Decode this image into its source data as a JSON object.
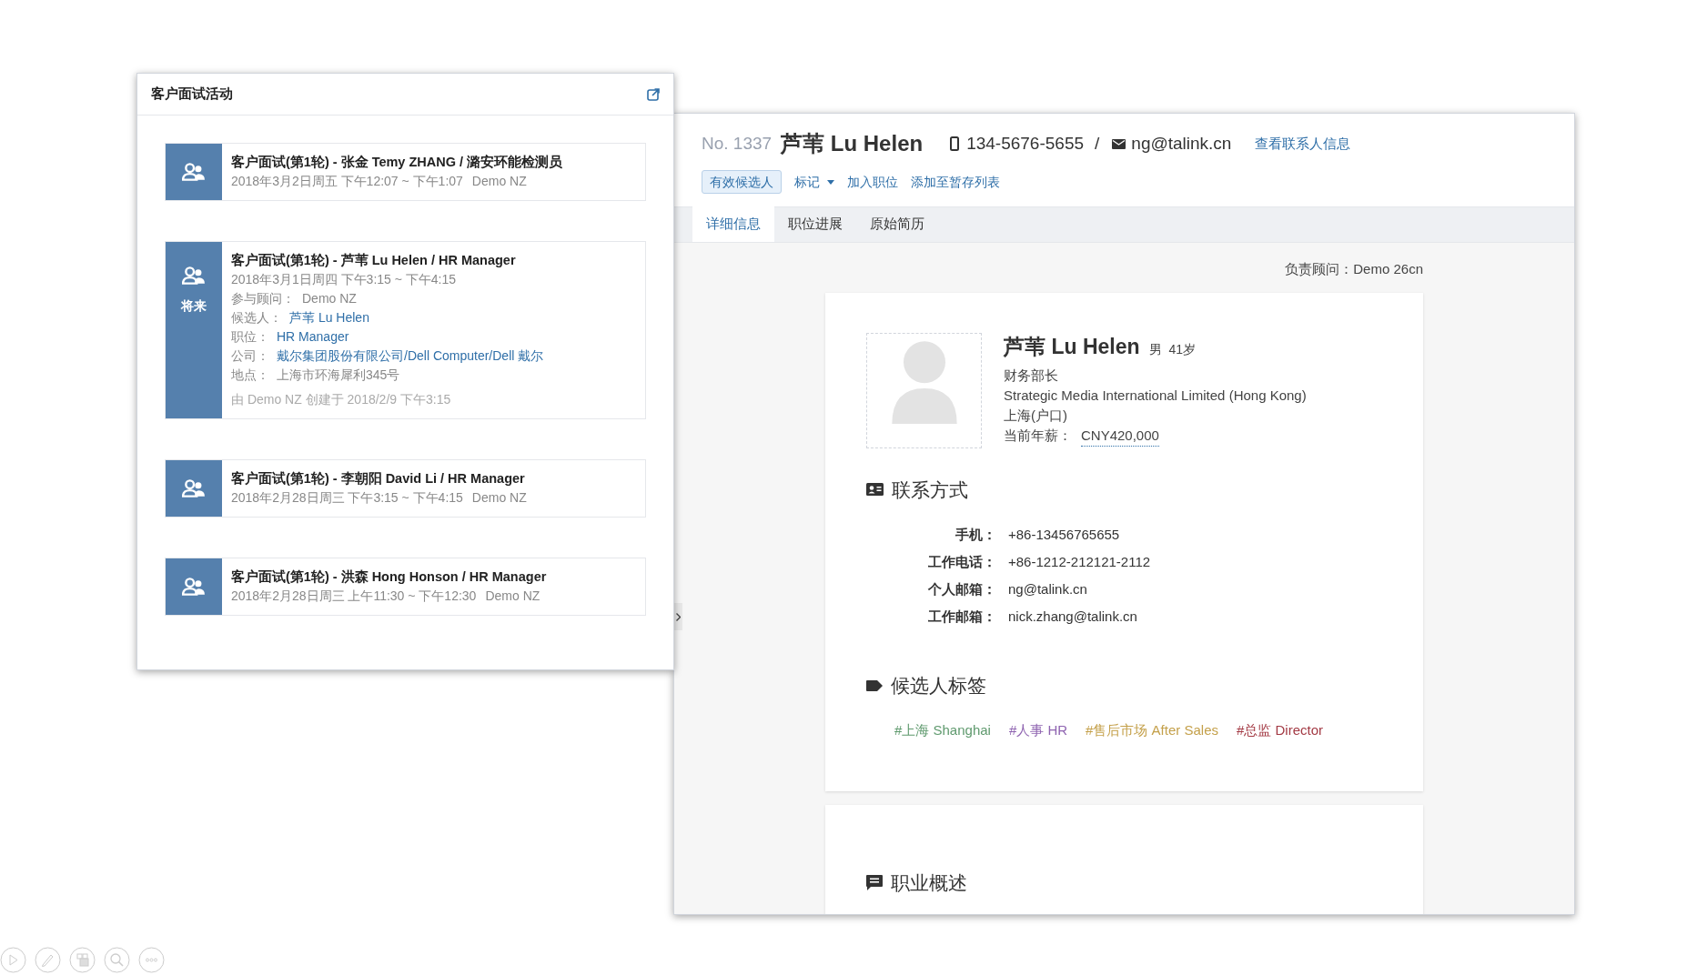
{
  "activity_panel": {
    "title": "客户面试活动",
    "activities": [
      {
        "title": "客户面试(第1轮) - 张金 Temy ZHANG / 潞安环能检测员",
        "time": "2018年3月2日周五 下午12:07 ~ 下午1:07",
        "consultant": "Demo NZ"
      },
      {
        "title": "客户面试(第1轮) - 芦苇 Lu Helen / HR Manager",
        "badge": "将来",
        "time": "2018年3月1日周四 下午3:15 ~ 下午4:15",
        "details": [
          {
            "label": "参与顾问：",
            "value": "Demo NZ",
            "link": false
          },
          {
            "label": "候选人：",
            "value": "芦苇 Lu Helen",
            "link": true
          },
          {
            "label": "职位：",
            "value": "HR Manager",
            "link": true
          },
          {
            "label": "公司：",
            "value": "戴尔集团股份有限公司/Dell Computer/Dell 戴尔",
            "link": true
          },
          {
            "label": "地点：",
            "value": "上海市环海犀利345号",
            "link": false
          }
        ],
        "created": "由 Demo NZ 创建于 2018/2/9 下午3:15"
      },
      {
        "title": "客户面试(第1轮) - 李朝阳 David Li / HR Manager",
        "time": "2018年2月28日周三 下午3:15 ~ 下午4:15",
        "consultant": "Demo NZ"
      },
      {
        "title": "客户面试(第1轮) - 洪森 Hong Honson / HR Manager",
        "time": "2018年2月28日周三 上午11:30 ~ 下午12:30",
        "consultant": "Demo NZ"
      }
    ]
  },
  "candidate_panel": {
    "number": "No. 1337",
    "name": "芦苇 Lu Helen",
    "phone": "134-5676-5655",
    "separator": "/",
    "email": "ng@talink.cn",
    "contact_link": "查看联系人信息",
    "actions": [
      {
        "label": "有效候选人",
        "kind": "status"
      },
      {
        "label": "标记",
        "kind": "dropdown"
      },
      {
        "label": "加入职位",
        "kind": "link"
      },
      {
        "label": "添加至暂存列表",
        "kind": "link"
      }
    ],
    "tabs": [
      {
        "label": "详细信息",
        "selected": true
      },
      {
        "label": "职位进展",
        "selected": false
      },
      {
        "label": "原始简历",
        "selected": false
      }
    ],
    "owner": "负责顾问：Demo 26cn",
    "profile": {
      "name": "芦苇 Lu Helen",
      "gender": "男",
      "age": "41岁",
      "title": "财务部长",
      "company": "Strategic Media International Limited (Hong Kong)",
      "location": "上海(户口)",
      "salary_label": "当前年薪：",
      "salary": "CNY420,000"
    },
    "contact_section": {
      "title": "联系方式",
      "rows": [
        {
          "label": "手机：",
          "value": "+86-13456765655"
        },
        {
          "label": "工作电话：",
          "value": "+86-1212-212121-2112"
        },
        {
          "label": "个人邮箱：",
          "value": "ng@talink.cn"
        },
        {
          "label": "工作邮箱：",
          "value": "nick.zhang@talink.cn"
        }
      ]
    },
    "tags_section": {
      "title": "候选人标签",
      "tags": [
        {
          "label": "#上海 Shanghai",
          "color": "#5f9a6e"
        },
        {
          "label": "#人事 HR",
          "color": "#8e63b0"
        },
        {
          "label": "#售后市场 After Sales",
          "color": "#c4a04a"
        },
        {
          "label": "#总监 Director",
          "color": "#a33a44"
        }
      ]
    },
    "summary_section": {
      "title": "职业概述"
    }
  }
}
